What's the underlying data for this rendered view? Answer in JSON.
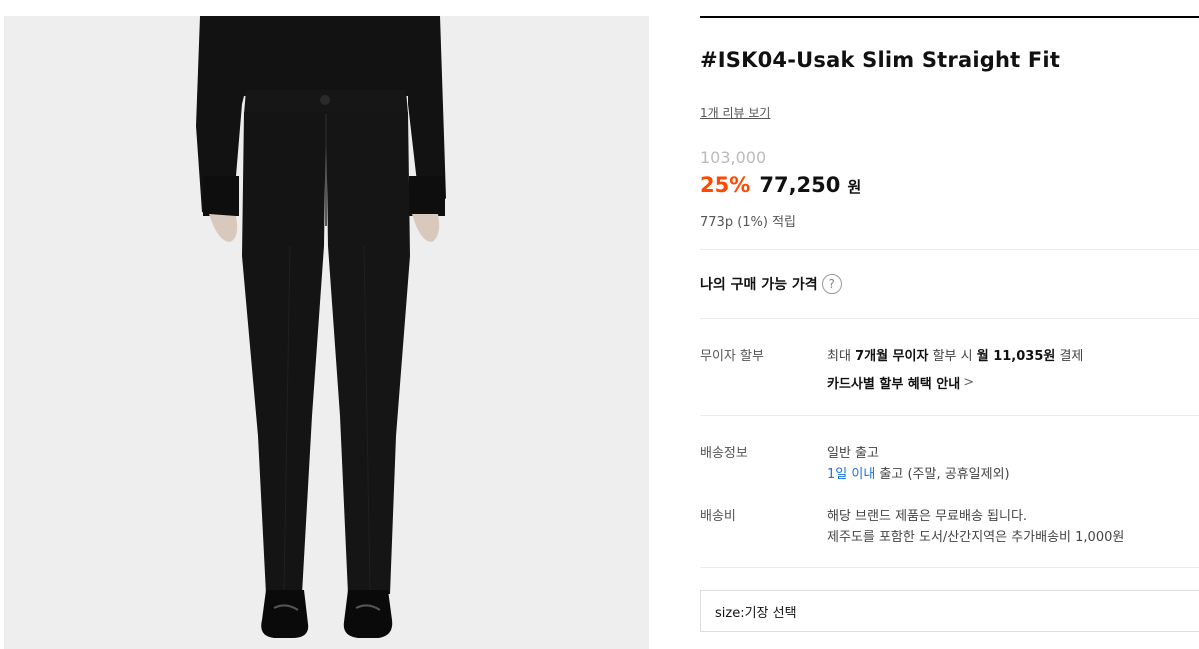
{
  "product": {
    "title": "#ISK04-Usak Slim Straight Fit",
    "review_link": "1개 리뷰 보기",
    "original_price": "103,000",
    "discount_rate": "25%",
    "sale_price": "77,250",
    "currency": "원",
    "points": "773p (1%) 적립"
  },
  "my_price": {
    "label": "나의 구매 가능 가격",
    "help_icon": "question-circle-icon",
    "help_glyph": "?"
  },
  "installment": {
    "label": "무이자 할부",
    "text_prefix": "최대 ",
    "months": "7개월 무이자",
    "text_mid": " 할부 시 ",
    "monthly": "월 11,035원",
    "text_suffix": " 결제",
    "card_link": "카드사별 할부 혜택 안내",
    "chevron": ">"
  },
  "shipping": {
    "label": "배송정보",
    "type": "일반 출고",
    "eta_highlight": "1일 이내",
    "eta_rest": " 출고 (주말, 공휴일제외)"
  },
  "shipping_fee": {
    "label": "배송비",
    "line1": "해당 브랜드 제품은 무료배송 됩니다.",
    "line2": "제주도를 포함한 도서/산간지역은 추가배송비 1,000원"
  },
  "option_select": {
    "value": "size:기장 선택"
  },
  "colors": {
    "accent": "#ff4800",
    "link_blue": "#1a73e8",
    "photo_bg": "#eeeeee",
    "garment": "#141414"
  }
}
